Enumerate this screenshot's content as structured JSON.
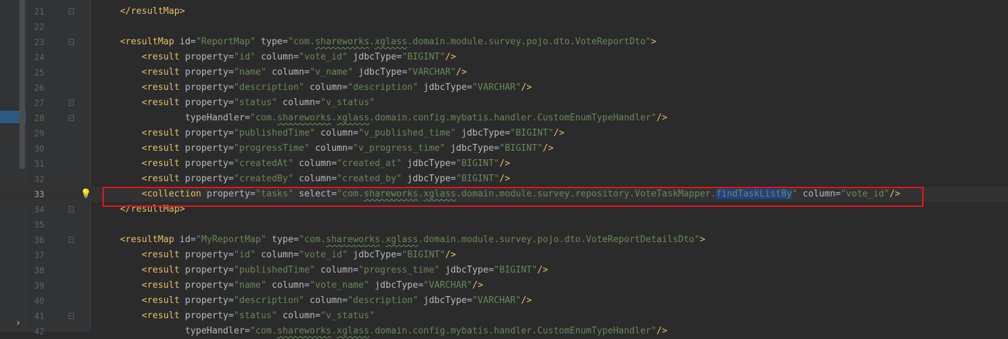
{
  "editor": {
    "language": "xml",
    "current_line": 33,
    "selected_text": "findTaskListBy",
    "colors": {
      "background": "#2b2b2b",
      "tag": "#e8bf6a",
      "attribute": "#bababa",
      "value": "#6a8759",
      "selection": "#214283",
      "annotation_box": "#e8141d"
    },
    "lines": [
      {
        "n": "21",
        "fold": true,
        "segments": [
          [
            "    ",
            "p"
          ],
          [
            "</resultMap>",
            "t"
          ]
        ]
      },
      {
        "n": "22",
        "fold": false,
        "segments": []
      },
      {
        "n": "23",
        "fold": true,
        "segments": [
          [
            "    ",
            "p"
          ],
          [
            "<resultMap ",
            "t"
          ],
          [
            "id",
            "a"
          ],
          [
            "=",
            "p"
          ],
          [
            "\"ReportMap\"",
            "v"
          ],
          [
            " type",
            "a"
          ],
          [
            "=",
            "p"
          ],
          [
            "\"com.",
            "v"
          ],
          [
            "shareworks",
            "vw"
          ],
          [
            ".",
            "v"
          ],
          [
            "xglass",
            "vw"
          ],
          [
            ".domain.module.survey.pojo.dto.VoteReportDto\"",
            "v"
          ],
          [
            ">",
            "t"
          ]
        ]
      },
      {
        "n": "24",
        "fold": false,
        "segments": [
          [
            "        ",
            "p"
          ],
          [
            "<result ",
            "t"
          ],
          [
            "property",
            "a"
          ],
          [
            "=",
            "p"
          ],
          [
            "\"id\"",
            "v"
          ],
          [
            " column",
            "a"
          ],
          [
            "=",
            "p"
          ],
          [
            "\"vote_id\"",
            "v"
          ],
          [
            " jdbcType",
            "a"
          ],
          [
            "=",
            "p"
          ],
          [
            "\"BIGINT\"",
            "v"
          ],
          [
            "/>",
            "t"
          ]
        ]
      },
      {
        "n": "25",
        "fold": false,
        "segments": [
          [
            "        ",
            "p"
          ],
          [
            "<result ",
            "t"
          ],
          [
            "property",
            "a"
          ],
          [
            "=",
            "p"
          ],
          [
            "\"name\"",
            "v"
          ],
          [
            " column",
            "a"
          ],
          [
            "=",
            "p"
          ],
          [
            "\"v_name\"",
            "v"
          ],
          [
            " jdbcType",
            "a"
          ],
          [
            "=",
            "p"
          ],
          [
            "\"VARCHAR\"",
            "v"
          ],
          [
            "/>",
            "t"
          ]
        ]
      },
      {
        "n": "26",
        "fold": false,
        "segments": [
          [
            "        ",
            "p"
          ],
          [
            "<result ",
            "t"
          ],
          [
            "property",
            "a"
          ],
          [
            "=",
            "p"
          ],
          [
            "\"description\"",
            "v"
          ],
          [
            " column",
            "a"
          ],
          [
            "=",
            "p"
          ],
          [
            "\"description\"",
            "v"
          ],
          [
            " jdbcType",
            "a"
          ],
          [
            "=",
            "p"
          ],
          [
            "\"VARCHAR\"",
            "v"
          ],
          [
            "/>",
            "t"
          ]
        ]
      },
      {
        "n": "27",
        "fold": true,
        "segments": [
          [
            "        ",
            "p"
          ],
          [
            "<result ",
            "t"
          ],
          [
            "property",
            "a"
          ],
          [
            "=",
            "p"
          ],
          [
            "\"status\"",
            "v"
          ],
          [
            " column",
            "a"
          ],
          [
            "=",
            "p"
          ],
          [
            "\"v_status\"",
            "v"
          ]
        ]
      },
      {
        "n": "28",
        "fold": true,
        "segments": [
          [
            "                ",
            "p"
          ],
          [
            "typeHandler",
            "a"
          ],
          [
            "=",
            "p"
          ],
          [
            "\"com.",
            "v"
          ],
          [
            "shareworks",
            "vw"
          ],
          [
            ".",
            "v"
          ],
          [
            "xglass",
            "vw"
          ],
          [
            ".domain.config.mybatis.handler.CustomEnumTypeHandler\"",
            "v"
          ],
          [
            "/>",
            "t"
          ]
        ]
      },
      {
        "n": "29",
        "fold": false,
        "segments": [
          [
            "        ",
            "p"
          ],
          [
            "<result ",
            "t"
          ],
          [
            "property",
            "a"
          ],
          [
            "=",
            "p"
          ],
          [
            "\"publishedTime\"",
            "v"
          ],
          [
            " column",
            "a"
          ],
          [
            "=",
            "p"
          ],
          [
            "\"v_published_time\"",
            "v"
          ],
          [
            " jdbcType",
            "a"
          ],
          [
            "=",
            "p"
          ],
          [
            "\"BIGINT\"",
            "v"
          ],
          [
            "/>",
            "t"
          ]
        ]
      },
      {
        "n": "30",
        "fold": false,
        "segments": [
          [
            "        ",
            "p"
          ],
          [
            "<result ",
            "t"
          ],
          [
            "property",
            "a"
          ],
          [
            "=",
            "p"
          ],
          [
            "\"progressTime\"",
            "v"
          ],
          [
            " column",
            "a"
          ],
          [
            "=",
            "p"
          ],
          [
            "\"v_progress_time\"",
            "v"
          ],
          [
            " jdbcType",
            "a"
          ],
          [
            "=",
            "p"
          ],
          [
            "\"BIGINT\"",
            "v"
          ],
          [
            "/>",
            "t"
          ]
        ]
      },
      {
        "n": "31",
        "fold": false,
        "segments": [
          [
            "        ",
            "p"
          ],
          [
            "<result ",
            "t"
          ],
          [
            "property",
            "a"
          ],
          [
            "=",
            "p"
          ],
          [
            "\"createdAt\"",
            "v"
          ],
          [
            " column",
            "a"
          ],
          [
            "=",
            "p"
          ],
          [
            "\"created_at\"",
            "v"
          ],
          [
            " jdbcType",
            "a"
          ],
          [
            "=",
            "p"
          ],
          [
            "\"BIGINT\"",
            "v"
          ],
          [
            "/>",
            "t"
          ]
        ]
      },
      {
        "n": "32",
        "fold": false,
        "segments": [
          [
            "        ",
            "p"
          ],
          [
            "<result ",
            "t"
          ],
          [
            "property",
            "a"
          ],
          [
            "=",
            "p"
          ],
          [
            "\"createdBy\"",
            "v"
          ],
          [
            " column",
            "a"
          ],
          [
            "=",
            "p"
          ],
          [
            "\"created_by\"",
            "v"
          ],
          [
            " jdbcType",
            "a"
          ],
          [
            "=",
            "p"
          ],
          [
            "\"BIGINT\"",
            "v"
          ],
          [
            "/>",
            "t"
          ]
        ]
      },
      {
        "n": "33",
        "fold": false,
        "bulb": true,
        "segments": [
          [
            "        ",
            "p"
          ],
          [
            "<collection ",
            "t"
          ],
          [
            "property",
            "a"
          ],
          [
            "=",
            "p"
          ],
          [
            "\"tasks\"",
            "v"
          ],
          [
            " select",
            "a"
          ],
          [
            "=",
            "p"
          ],
          [
            "\"com.",
            "v"
          ],
          [
            "shareworks",
            "vw"
          ],
          [
            ".",
            "v"
          ],
          [
            "xglass",
            "vw"
          ],
          [
            ".domain.module.survey.repository.VoteTaskMapper.",
            "v"
          ],
          [
            "findTaskListBy",
            "sel"
          ],
          [
            "\"",
            "v"
          ],
          [
            " column",
            "a"
          ],
          [
            "=",
            "p"
          ],
          [
            "\"vote_id\"",
            "v"
          ],
          [
            "/>",
            "t"
          ]
        ]
      },
      {
        "n": "34",
        "fold": true,
        "segments": [
          [
            "    ",
            "p"
          ],
          [
            "</resultMap>",
            "t"
          ]
        ]
      },
      {
        "n": "35",
        "fold": false,
        "segments": []
      },
      {
        "n": "36",
        "fold": true,
        "segments": [
          [
            "    ",
            "p"
          ],
          [
            "<resultMap ",
            "t"
          ],
          [
            "id",
            "a"
          ],
          [
            "=",
            "p"
          ],
          [
            "\"MyReportMap\"",
            "v"
          ],
          [
            " type",
            "a"
          ],
          [
            "=",
            "p"
          ],
          [
            "\"com.",
            "v"
          ],
          [
            "shareworks",
            "vw"
          ],
          [
            ".",
            "v"
          ],
          [
            "xglass",
            "vw"
          ],
          [
            ".domain.module.survey.pojo.dto.VoteReportDetailsDto\"",
            "v"
          ],
          [
            ">",
            "t"
          ]
        ]
      },
      {
        "n": "37",
        "fold": false,
        "segments": [
          [
            "        ",
            "p"
          ],
          [
            "<result ",
            "t"
          ],
          [
            "property",
            "a"
          ],
          [
            "=",
            "p"
          ],
          [
            "\"id\"",
            "v"
          ],
          [
            " column",
            "a"
          ],
          [
            "=",
            "p"
          ],
          [
            "\"vote_id\"",
            "v"
          ],
          [
            " jdbcType",
            "a"
          ],
          [
            "=",
            "p"
          ],
          [
            "\"BIGINT\"",
            "v"
          ],
          [
            "/>",
            "t"
          ]
        ]
      },
      {
        "n": "38",
        "fold": false,
        "segments": [
          [
            "        ",
            "p"
          ],
          [
            "<result ",
            "t"
          ],
          [
            "property",
            "a"
          ],
          [
            "=",
            "p"
          ],
          [
            "\"publishedTime\"",
            "v"
          ],
          [
            " column",
            "a"
          ],
          [
            "=",
            "p"
          ],
          [
            "\"progress_time\"",
            "v"
          ],
          [
            " jdbcType",
            "a"
          ],
          [
            "=",
            "p"
          ],
          [
            "\"BIGINT\"",
            "v"
          ],
          [
            "/>",
            "t"
          ]
        ]
      },
      {
        "n": "39",
        "fold": false,
        "segments": [
          [
            "        ",
            "p"
          ],
          [
            "<result ",
            "t"
          ],
          [
            "property",
            "a"
          ],
          [
            "=",
            "p"
          ],
          [
            "\"name\"",
            "v"
          ],
          [
            " column",
            "a"
          ],
          [
            "=",
            "p"
          ],
          [
            "\"vote_name\"",
            "v"
          ],
          [
            " jdbcType",
            "a"
          ],
          [
            "=",
            "p"
          ],
          [
            "\"VARCHAR\"",
            "v"
          ],
          [
            "/>",
            "t"
          ]
        ]
      },
      {
        "n": "40",
        "fold": false,
        "segments": [
          [
            "        ",
            "p"
          ],
          [
            "<result ",
            "t"
          ],
          [
            "property",
            "a"
          ],
          [
            "=",
            "p"
          ],
          [
            "\"description\"",
            "v"
          ],
          [
            " column",
            "a"
          ],
          [
            "=",
            "p"
          ],
          [
            "\"description\"",
            "v"
          ],
          [
            " jdbcType",
            "a"
          ],
          [
            "=",
            "p"
          ],
          [
            "\"VARCHAR\"",
            "v"
          ],
          [
            "/>",
            "t"
          ]
        ]
      },
      {
        "n": "41",
        "fold": true,
        "segments": [
          [
            "        ",
            "p"
          ],
          [
            "<result ",
            "t"
          ],
          [
            "property",
            "a"
          ],
          [
            "=",
            "p"
          ],
          [
            "\"status\"",
            "v"
          ],
          [
            " column",
            "a"
          ],
          [
            "=",
            "p"
          ],
          [
            "\"v_status\"",
            "v"
          ]
        ]
      },
      {
        "n": "42",
        "fold": false,
        "segments": [
          [
            "                ",
            "p"
          ],
          [
            "typeHandler",
            "a"
          ],
          [
            "=",
            "p"
          ],
          [
            "\"com.",
            "v"
          ],
          [
            "shareworks",
            "vw"
          ],
          [
            ".",
            "v"
          ],
          [
            "xglass",
            "vw"
          ],
          [
            ".domain.config.mybatis.handler.CustomEnumTypeHandler\"",
            "v"
          ],
          [
            "/>",
            "t"
          ]
        ]
      }
    ]
  }
}
